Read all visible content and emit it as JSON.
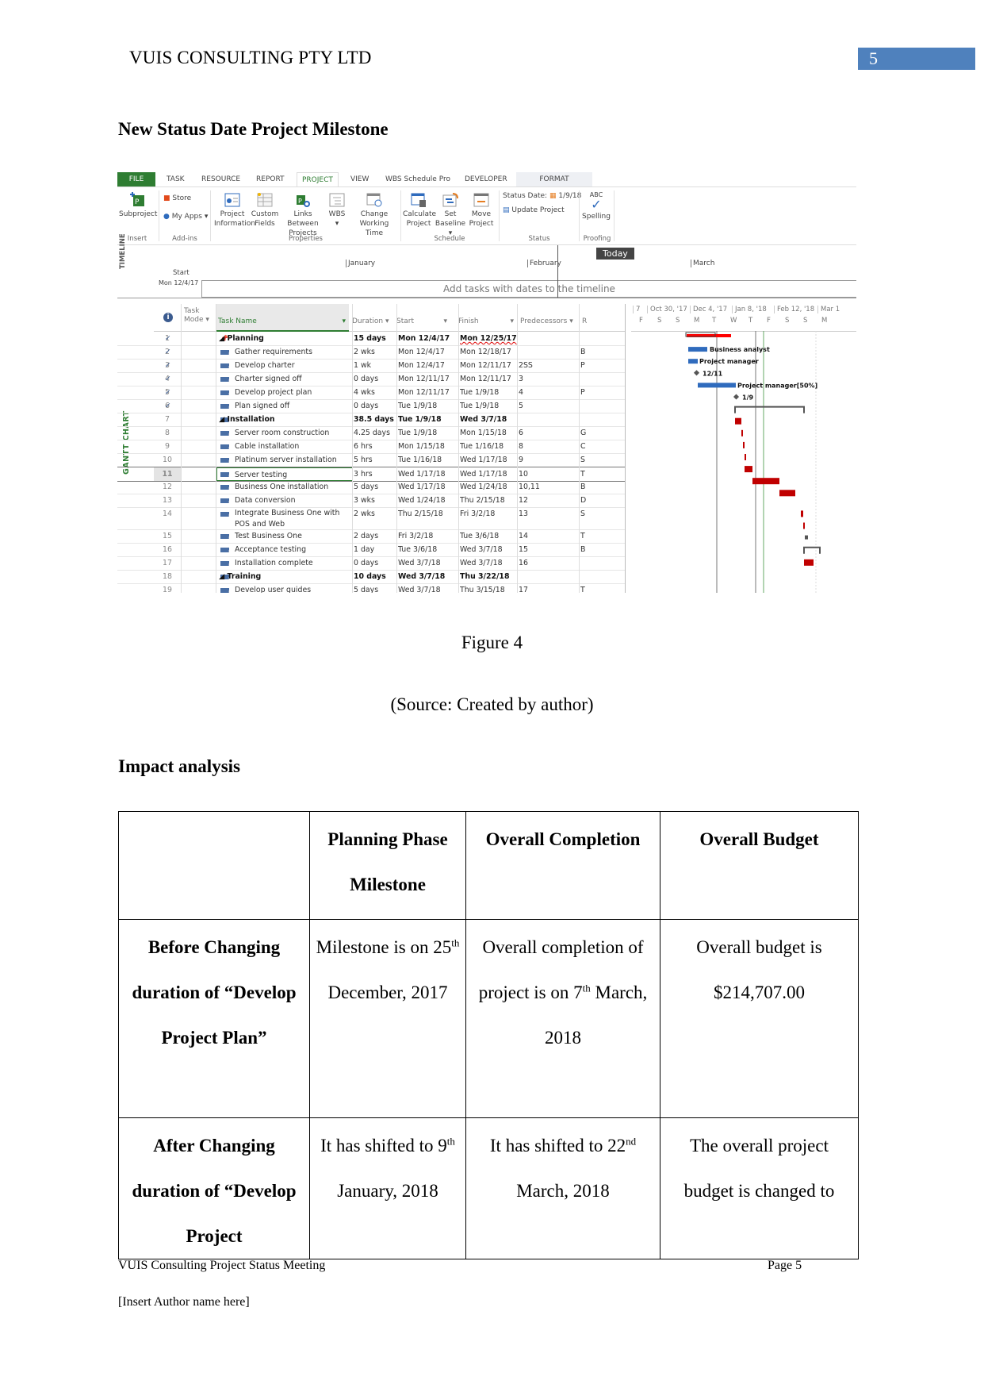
{
  "header": {
    "company": "VUIS CONSULTING PTY LTD",
    "page_number": "5"
  },
  "section_title": "New Status Date Project Milestone",
  "screenshot": {
    "tabs": [
      "FILE",
      "TASK",
      "RESOURCE",
      "REPORT",
      "PROJECT",
      "VIEW",
      "WBS Schedule Pro",
      "DEVELOPER",
      "FORMAT"
    ],
    "active_tab": "PROJECT",
    "ribbon": {
      "subproject": "Subproject",
      "store": "Store",
      "my_apps": "My Apps",
      "project_information": [
        "Project",
        "Information"
      ],
      "custom_fields": [
        "Custom",
        "Fields"
      ],
      "links_between_projects": [
        "Links Between",
        "Projects"
      ],
      "wbs": "WBS",
      "change_working_time": [
        "Change",
        "Working Time"
      ],
      "calculate_project": [
        "Calculate",
        "Project"
      ],
      "set_baseline": [
        "Set",
        "Baseline"
      ],
      "move_project": [
        "Move",
        "Project"
      ],
      "status_date_label": "Status Date:",
      "status_date_value": "1/9/18",
      "update_project": "Update Project",
      "spelling_abc": "ABC",
      "spelling": "Spelling",
      "groups": [
        "Insert",
        "Add-ins",
        "Properties",
        "Schedule",
        "Status",
        "Proofing"
      ]
    },
    "timeline": {
      "vertical_label": "TIMELINE",
      "today": "Today",
      "months": [
        "January",
        "February",
        "March"
      ],
      "start_label": "Start",
      "start_date": "Mon 12/4/17",
      "placeholder": "Add tasks with dates to the timeline"
    },
    "gantt_label": "GANTT CHART",
    "columns": {
      "info": "i",
      "mode": [
        "Task",
        "Mode"
      ],
      "name": "Task Name",
      "duration": "Duration",
      "start": "Start",
      "finish": "Finish",
      "predecessors": "Predecessors",
      "resource_initial": "R"
    },
    "chart_header": {
      "weeks": [
        "7",
        "Oct 30, '17",
        "Dec 4, '17",
        "Jan 8, '18",
        "Feb 12, '18",
        "Mar 1"
      ],
      "days": [
        "F",
        "S",
        "S",
        "M",
        "T",
        "W",
        "T",
        "F",
        "S",
        "S",
        "M"
      ]
    },
    "tasks": [
      {
        "id": "1",
        "done": true,
        "mode": "manual",
        "name": "Planning",
        "summary": true,
        "duration": "15 days",
        "start": "Mon 12/4/17",
        "finish": "Mon 12/25/17",
        "pred": "",
        "res": ""
      },
      {
        "id": "2",
        "done": true,
        "mode": "auto",
        "name": "Gather requirements",
        "summary": false,
        "duration": "2 wks",
        "start": "Mon 12/4/17",
        "finish": "Mon 12/18/17",
        "pred": "",
        "res": "B"
      },
      {
        "id": "3",
        "done": true,
        "mode": "auto",
        "name": "Develop charter",
        "summary": false,
        "duration": "1 wk",
        "start": "Mon 12/4/17",
        "finish": "Mon 12/11/17",
        "pred": "2SS",
        "res": "P"
      },
      {
        "id": "4",
        "done": true,
        "mode": "auto",
        "name": "Charter signed off",
        "summary": false,
        "duration": "0 days",
        "start": "Mon 12/11/17",
        "finish": "Mon 12/11/17",
        "pred": "3",
        "res": ""
      },
      {
        "id": "5",
        "done": true,
        "mode": "auto",
        "name": "Develop project plan",
        "summary": false,
        "duration": "4 wks",
        "start": "Mon 12/11/17",
        "finish": "Tue 1/9/18",
        "pred": "4",
        "res": "P"
      },
      {
        "id": "6",
        "done": true,
        "mode": "auto",
        "name": "Plan signed off",
        "summary": false,
        "duration": "0 days",
        "start": "Tue 1/9/18",
        "finish": "Tue 1/9/18",
        "pred": "5",
        "res": ""
      },
      {
        "id": "7",
        "done": false,
        "mode": "auto",
        "name": "Installation",
        "summary": true,
        "duration": "38.5 days",
        "start": "Tue 1/9/18",
        "finish": "Wed 3/7/18",
        "pred": "",
        "res": ""
      },
      {
        "id": "8",
        "done": false,
        "mode": "auto",
        "name": "Server room construction",
        "summary": false,
        "duration": "4.25 days",
        "start": "Tue 1/9/18",
        "finish": "Mon 1/15/18",
        "pred": "6",
        "res": "G"
      },
      {
        "id": "9",
        "done": false,
        "mode": "auto",
        "name": "Cable installation",
        "summary": false,
        "duration": "6 hrs",
        "start": "Mon 1/15/18",
        "finish": "Tue 1/16/18",
        "pred": "8",
        "res": "C"
      },
      {
        "id": "10",
        "done": false,
        "mode": "auto",
        "name": "Platinum server installation",
        "summary": false,
        "duration": "5 hrs",
        "start": "Tue 1/16/18",
        "finish": "Wed 1/17/18",
        "pred": "9",
        "res": "S"
      },
      {
        "id": "11",
        "done": false,
        "mode": "auto",
        "name": "Server testing",
        "summary": false,
        "duration": "3 hrs",
        "start": "Wed 1/17/18",
        "finish": "Wed 1/17/18",
        "pred": "10",
        "res": "T",
        "selected": true
      },
      {
        "id": "12",
        "done": false,
        "mode": "auto",
        "name": "Business One installation",
        "summary": false,
        "duration": "5 days",
        "start": "Wed 1/17/18",
        "finish": "Wed 1/24/18",
        "pred": "10,11",
        "res": "B"
      },
      {
        "id": "13",
        "done": false,
        "mode": "auto",
        "name": "Data conversion",
        "summary": false,
        "duration": "3 wks",
        "start": "Wed 1/24/18",
        "finish": "Thu 2/15/18",
        "pred": "12",
        "res": "D"
      },
      {
        "id": "14",
        "done": false,
        "mode": "auto",
        "name": "Integrate Business One with POS and Web",
        "summary": false,
        "duration": "2 wks",
        "start": "Thu 2/15/18",
        "finish": "Fri 3/2/18",
        "pred": "13",
        "res": "S"
      },
      {
        "id": "15",
        "done": false,
        "mode": "auto",
        "name": "Test Business One",
        "summary": false,
        "duration": "2 days",
        "start": "Fri 3/2/18",
        "finish": "Tue 3/6/18",
        "pred": "14",
        "res": "T"
      },
      {
        "id": "16",
        "done": false,
        "mode": "auto",
        "name": "Acceptance testing",
        "summary": false,
        "duration": "1 day",
        "start": "Tue 3/6/18",
        "finish": "Wed 3/7/18",
        "pred": "15",
        "res": "B"
      },
      {
        "id": "17",
        "done": false,
        "mode": "auto",
        "name": "Installation complete",
        "summary": false,
        "duration": "0 days",
        "start": "Wed 3/7/18",
        "finish": "Wed 3/7/18",
        "pred": "16",
        "res": ""
      },
      {
        "id": "18",
        "done": false,
        "mode": "auto",
        "name": "Training",
        "summary": true,
        "duration": "10 days",
        "start": "Wed 3/7/18",
        "finish": "Thu 3/22/18",
        "pred": "",
        "res": ""
      },
      {
        "id": "19",
        "done": false,
        "mode": "auto",
        "name": "Develop user guides",
        "summary": false,
        "duration": "5 days",
        "start": "Wed 3/7/18",
        "finish": "Thu 3/15/18",
        "pred": "17",
        "res": "T"
      }
    ],
    "bar_labels": {
      "business_analyst": "Business analyst",
      "project_manager": "Project manager",
      "charter_milestone": "12/11",
      "plan_resource": "Project manager[50%]",
      "plan_milestone": "1/9"
    },
    "colors": {
      "brand_green": "#2e7d32",
      "task_blue": "#2f6bbd",
      "critical_red": "#c00000",
      "summary_red": "#ff0000"
    }
  },
  "figure_caption": "Figure 4",
  "figure_source": "(Source: Created by author)",
  "impact_title": "Impact analysis",
  "impact_table": {
    "headers": [
      "",
      "Planning Phase Milestone",
      "Overall Completion",
      "Overall Budget"
    ],
    "rows": [
      {
        "label": "Before Changing duration of “Develop Project Plan”",
        "milestone": {
          "pre": "Milestone is on 25",
          "sup": "th",
          "post": " December, 2017"
        },
        "completion": {
          "pre": "Overall completion of project is on 7",
          "sup": "th",
          "post": " March, 2018"
        },
        "budget": "Overall budget is $214,707.00"
      },
      {
        "label": "After Changing duration of “Develop Project",
        "milestone": {
          "pre": "It has shifted to 9",
          "sup": "th",
          "post": " January, 2018"
        },
        "completion": {
          "pre": "It has shifted to 22",
          "sup": "nd",
          "post": " March, 2018"
        },
        "budget": "The overall project budget is changed to"
      }
    ]
  },
  "footer": {
    "title": "VUIS Consulting Project Status Meeting",
    "page": "Page 5",
    "author": "[Insert Author name here]"
  }
}
